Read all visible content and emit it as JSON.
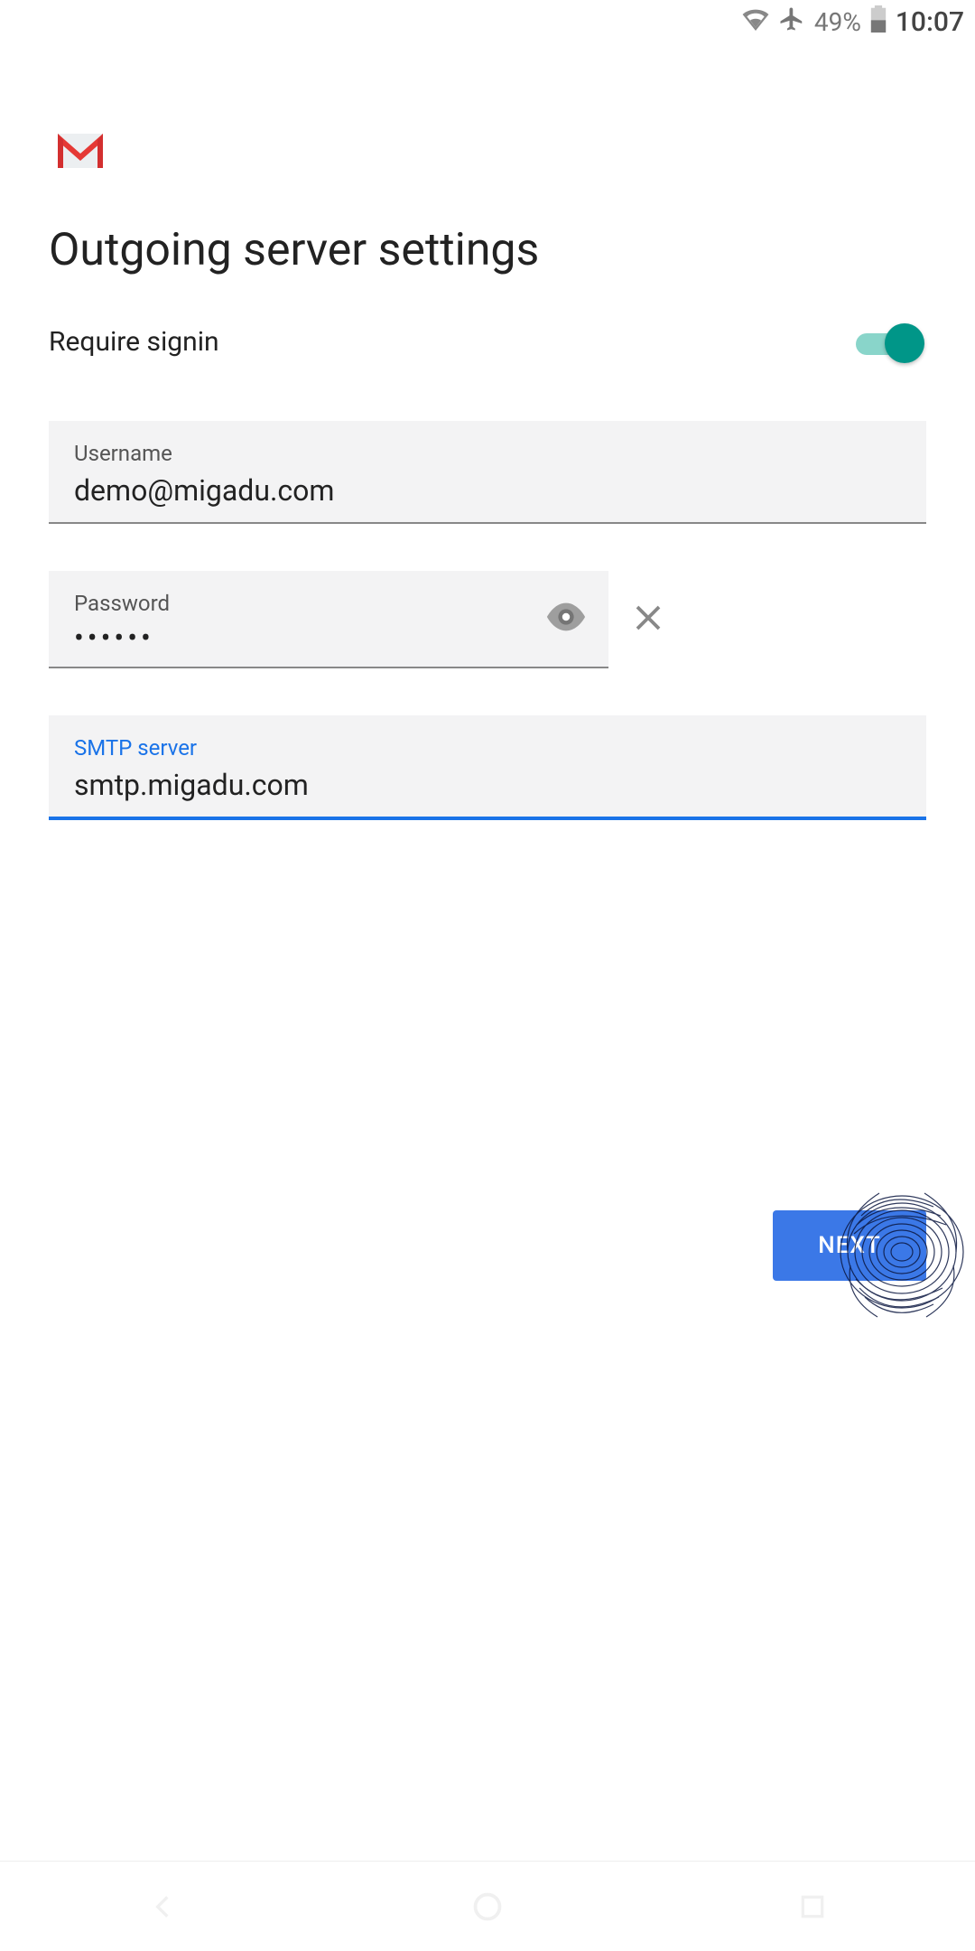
{
  "status_bar": {
    "battery_pct": "49%",
    "time": "10:07"
  },
  "page": {
    "title": "Outgoing server settings"
  },
  "toggle": {
    "label": "Require signin",
    "on": true
  },
  "fields": {
    "username": {
      "label": "Username",
      "value": "demo@migadu.com"
    },
    "password": {
      "label": "Password",
      "masked_value": "••••••"
    },
    "smtp": {
      "label": "SMTP server",
      "value": "smtp.migadu.com"
    }
  },
  "buttons": {
    "next": "NEXT"
  }
}
